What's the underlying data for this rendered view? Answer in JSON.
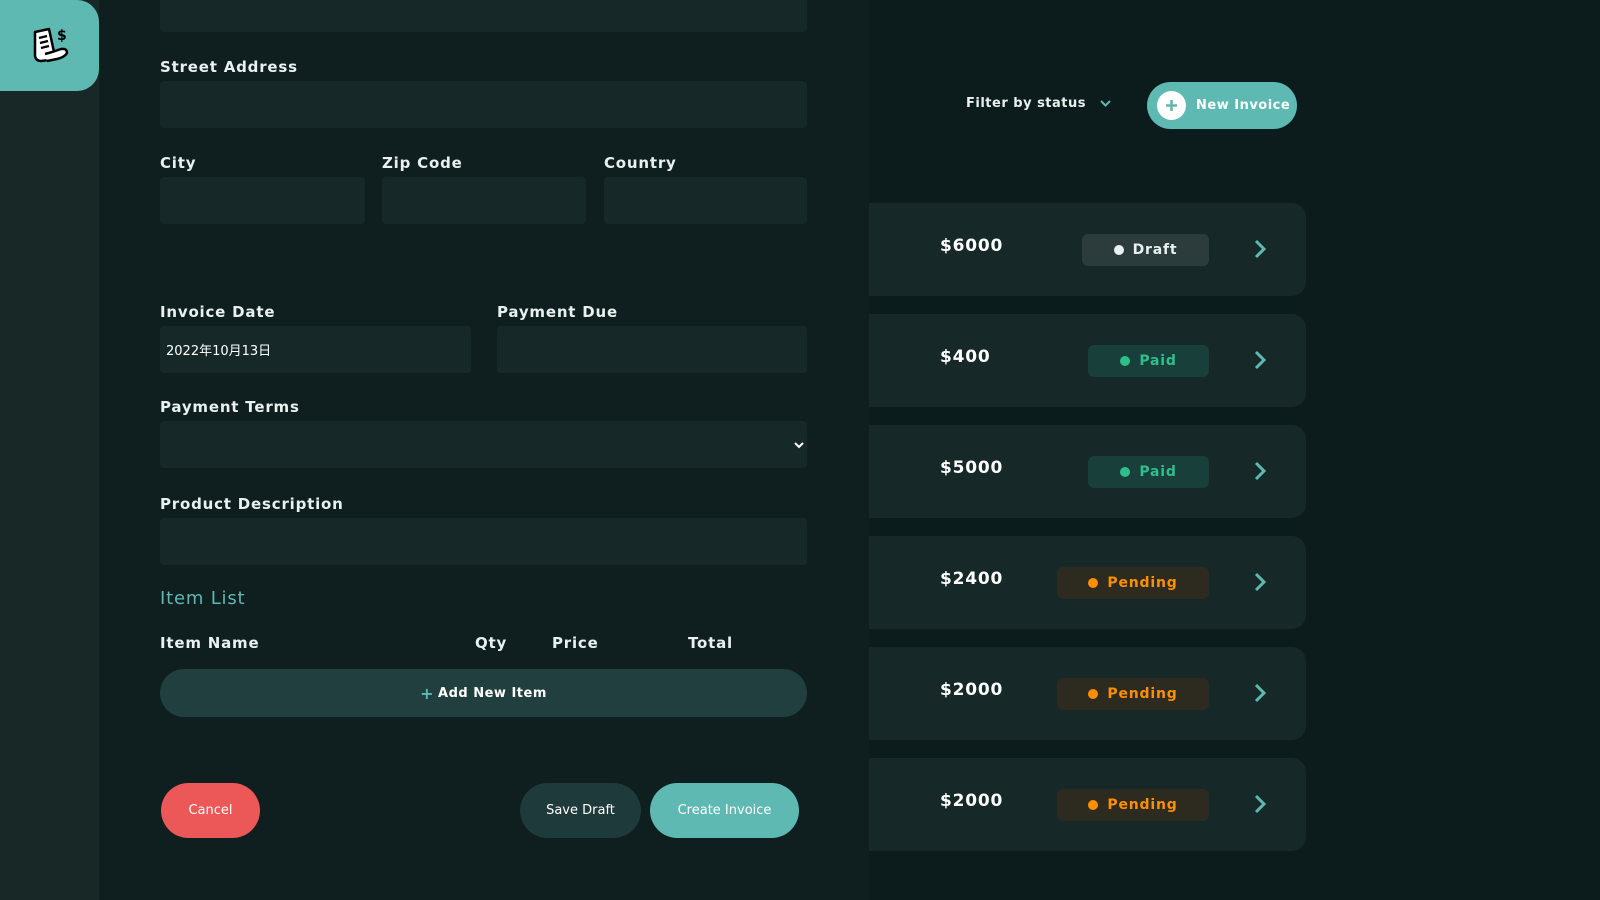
{
  "sidebar": {
    "logo_icon": "receipt-dollar-icon"
  },
  "header": {
    "filter_label": "Filter by status",
    "new_invoice_label": "New Invoice"
  },
  "invoices": [
    {
      "amount": "$6000",
      "status": "Draft"
    },
    {
      "amount": "$400",
      "status": "Paid"
    },
    {
      "amount": "$5000",
      "status": "Paid"
    },
    {
      "amount": "$2400",
      "status": "Pending"
    },
    {
      "amount": "$2000",
      "status": "Pending"
    },
    {
      "amount": "$2000",
      "status": "Pending"
    }
  ],
  "form": {
    "street_label": "Street Address",
    "city_label": "City",
    "zip_label": "Zip Code",
    "country_label": "Country",
    "invoice_date_label": "Invoice Date",
    "invoice_date_value": "2022年10月13日",
    "payment_due_label": "Payment Due",
    "payment_terms_label": "Payment Terms",
    "product_description_label": "Product Description",
    "item_list_title": "Item List",
    "col_item_name": "Item Name",
    "col_qty": "Qty",
    "col_price": "Price",
    "col_total": "Total",
    "add_item_label": "Add New Item",
    "cancel_label": "Cancel",
    "save_draft_label": "Save Draft",
    "create_label": "Create Invoice"
  },
  "colors": {
    "accent": "#5fb9b3",
    "danger": "#ec5757",
    "paid": "#2fbf8a",
    "pending": "#ff8f00"
  }
}
